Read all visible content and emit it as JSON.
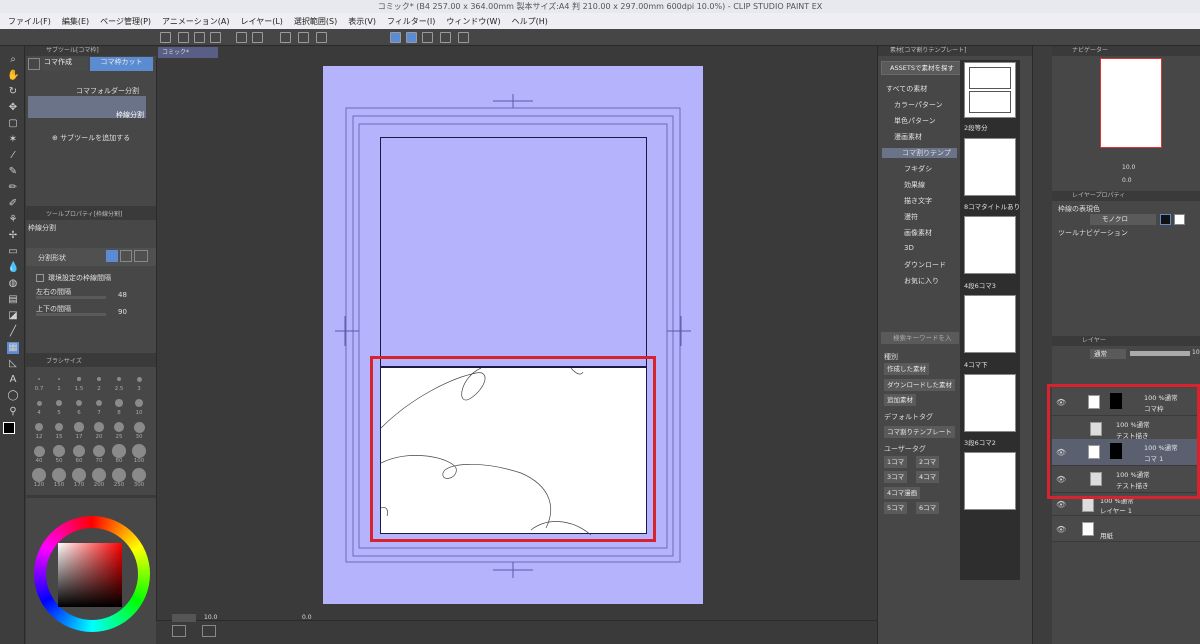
{
  "window": {
    "title": "コミック* (B4 257.00 x 364.00mm 製本サイズ:A4 判 210.00 x 297.00mm 600dpi 10.0%)  - CLIP STUDIO PAINT EX"
  },
  "menu": [
    "ファイル(F)",
    "編集(E)",
    "ページ管理(P)",
    "アニメーション(A)",
    "レイヤー(L)",
    "選択範囲(S)",
    "表示(V)",
    "フィルター(I)",
    "ウィンドウ(W)",
    "ヘルプ(H)"
  ],
  "subtool": {
    "panel_title": "サブツール[コマ枠]",
    "tab1": "コマ作成",
    "tab2": "コマ枠カット",
    "items": [
      "コマフォルダー分割",
      "枠線分割"
    ],
    "add_label": "サブツールを追加する"
  },
  "toolprop": {
    "panel_title": "ツールプロパティ[枠線分割]",
    "name": "枠線分割",
    "shape_label": "分割形状",
    "env_label": "環境設定の枠線間隔",
    "lr_label": "左右の間隔",
    "lr_value": "48",
    "tb_label": "上下の間隔",
    "tb_value": "90"
  },
  "brushsize": {
    "panel_title": "ブラシサイズ",
    "sizes": [
      "0.7",
      "1",
      "1.5",
      "2",
      "2.5",
      "3",
      "4",
      "5",
      "6",
      "7",
      "8",
      "10",
      "12",
      "15",
      "17",
      "20",
      "25",
      "30",
      "40",
      "50",
      "60",
      "70",
      "80",
      "100",
      "120",
      "150",
      "170",
      "200",
      "250",
      "300"
    ]
  },
  "canvas": {
    "tab_label": "コミック*",
    "zoom": "10.0",
    "angle": "0.0"
  },
  "material": {
    "panel_title": "素材[コマ割りテンプレート]",
    "assets_button": "ASSETSで素材を探す",
    "tree": [
      "すべての素材",
      "カラーパターン",
      "単色パターン",
      "漫画素材",
      "コマ割りテンプ",
      "フキダシ",
      "効果線",
      "描き文字",
      "漫符",
      "画像素材",
      "3D",
      "ダウンロード",
      "お気に入り"
    ],
    "search_placeholder": "検索キーワードを入",
    "kind_label": "種別",
    "tags": [
      "作成した素材",
      "ダウンロードした素材",
      "追加素材"
    ],
    "default_tag_label": "デフォルトタグ",
    "default_tags": [
      "コマ割りテンプレート"
    ],
    "user_tag_label": "ユーザータグ",
    "user_tags": [
      "1コマ",
      "2コマ",
      "3コマ",
      "4コマ",
      "4コマ漫画",
      "5コマ",
      "6コマ"
    ],
    "thumbs": [
      "2段等分",
      "8コマタイトルあり",
      "4段6コマ3",
      "4コマ下",
      "3段6コマ2"
    ]
  },
  "navigator": {
    "panel_title": "ナビゲーター",
    "zoom": "10.0",
    "angle": "0.0"
  },
  "layerprop": {
    "panel_title": "レイヤープロパティ",
    "color_label": "枠線の表現色",
    "color_value": "モノクロ",
    "toolnav_label": "ツールナビゲーション"
  },
  "layers": {
    "panel_title": "レイヤー",
    "blend": "通常",
    "opacity": "100",
    "items": [
      {
        "mode": "100 %通常",
        "name": "コマ枠"
      },
      {
        "mode": "100 %通常",
        "name": "テスト描き"
      },
      {
        "mode": "100 %通常",
        "name": "コマ 1"
      },
      {
        "mode": "100 %通常",
        "name": "テスト描き"
      },
      {
        "mode": "100 %通常",
        "name": "レイヤー 1"
      },
      {
        "mode": "",
        "name": "用紙"
      }
    ]
  },
  "colors": {
    "paper": "#b5b3fc",
    "highlight": "#d8222e",
    "selected_tab": "#5b8bd0"
  }
}
